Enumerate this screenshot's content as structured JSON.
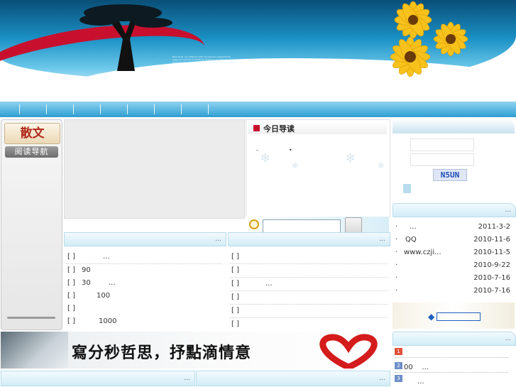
{
  "banner": {
    "caption_lines": [
      "Best of all, my relations with my parents unexpectedly",
      "deep and sincere of childhood experiences between us, the",
      "silence and comfort of the family, I love the moment with all"
    ]
  },
  "left_sidebar": {
    "logo_text": "散文",
    "nav_label": "阅读导航"
  },
  "today_guide": {
    "title": "今日导读",
    "dots": [
      "-",
      "•"
    ]
  },
  "login": {
    "captcha": "N5UN"
  },
  "news_list": {
    "more": "...",
    "items": [
      {
        "bullet": "·",
        "text": "...",
        "date": "2011-3-2"
      },
      {
        "bullet": "·",
        "text": "QQ",
        "date": "2010-11-6"
      },
      {
        "bullet": "·",
        "text": "www.czji...",
        "date": "2010-11-5"
      },
      {
        "bullet": "·",
        "text": "",
        "date": "2010-9-22"
      },
      {
        "bullet": "·",
        "text": "",
        "date": "2010-7-16"
      },
      {
        "bullet": "·",
        "text": "",
        "date": "2010-7-16"
      }
    ]
  },
  "center_left_list": {
    "more": "...",
    "items": [
      {
        "bracket": "[ ]",
        "text": "...",
        "indent": "         "
      },
      {
        "bracket": "[ ]",
        "text": "90",
        "indent": ""
      },
      {
        "bracket": "[ ]",
        "text": "30",
        "extra": "..."
      },
      {
        "bracket": "[ ]",
        "text": "100",
        "indent": "    "
      },
      {
        "bracket": "[ ]",
        "text": "",
        "indent": ""
      },
      {
        "bracket": "[ ]",
        "text": "1000",
        "indent": "      "
      }
    ]
  },
  "center_right_list": {
    "more": "...",
    "items": [
      {
        "bracket": "[ ]",
        "text": ""
      },
      {
        "bracket": "[ ]",
        "text": ""
      },
      {
        "bracket": "[ ]",
        "text": "..."
      },
      {
        "bracket": "[ ]",
        "text": ""
      },
      {
        "bracket": "[ ]",
        "text": ""
      },
      {
        "bracket": "[ ]",
        "text": ""
      }
    ]
  },
  "ad_banner": {
    "slogan": "寫分秒哲思，抒點滴情意"
  },
  "right_button": {
    "label": "◆"
  },
  "bottom_right_list": {
    "more": "...",
    "items": [
      {
        "num": "1",
        "text": ""
      },
      {
        "num": "2",
        "text": "00    ..."
      },
      {
        "num": "3",
        "text": "..."
      }
    ]
  },
  "bottom_panels": {
    "left_more": "...",
    "right_more": "..."
  },
  "colors": {
    "nav": "#2f9ed1",
    "brand_red": "#c8102e",
    "panel_border": "#b9dcea"
  }
}
